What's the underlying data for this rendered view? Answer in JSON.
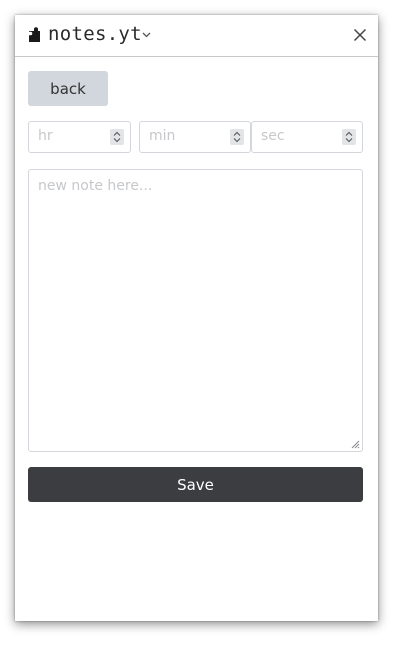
{
  "header": {
    "title": "notes.yt",
    "icon": "puzzle-piece-icon",
    "dropdown_icon": "chevron-down-icon",
    "close_icon": "close-icon"
  },
  "back_button": {
    "label": "back"
  },
  "time_inputs": [
    {
      "placeholder": "hr",
      "value": ""
    },
    {
      "placeholder": "min",
      "value": ""
    },
    {
      "placeholder": "sec",
      "value": ""
    }
  ],
  "note": {
    "placeholder": "new note here...",
    "value": ""
  },
  "save_button": {
    "label": "Save"
  },
  "colors": {
    "back_button_bg": "#d2d7de",
    "save_button_bg": "#3c3d41",
    "border": "#d3d6da",
    "placeholder": "#c6c8cb"
  }
}
